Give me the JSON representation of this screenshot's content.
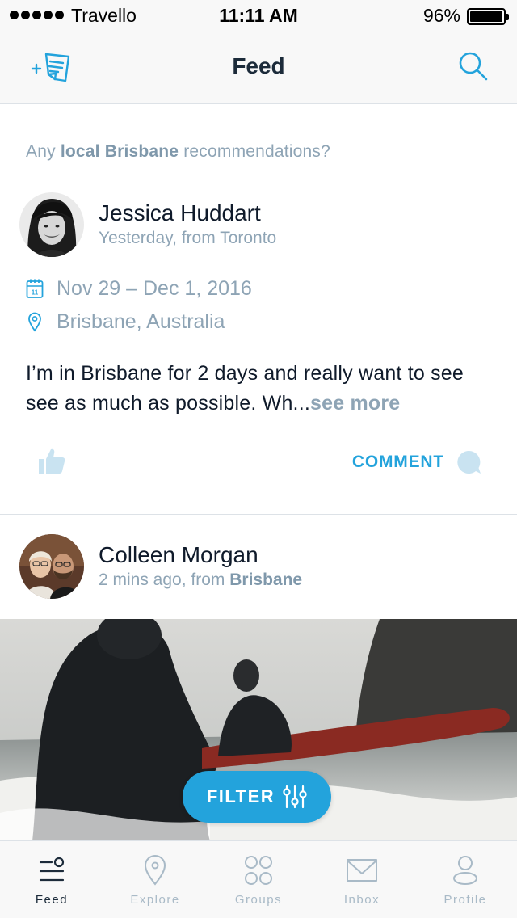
{
  "status_bar": {
    "carrier": "Travello",
    "time": "11:11 AM",
    "battery": "96%"
  },
  "nav": {
    "title": "Feed",
    "compose_icon": "compose-note-icon",
    "search_icon": "search-icon"
  },
  "post1": {
    "question_prefix": "Any ",
    "question_highlight": "local Brisbane",
    "question_suffix": " recommendations?",
    "author": "Jessica Huddart",
    "meta": "Yesterday, from Toronto",
    "dates": "Nov 29 – Dec 1, 2016",
    "location": "Brisbane, Australia",
    "body": "I’m in Brisbane for 2 days and really want to see see as much as possible. Wh...",
    "see_more": "see more",
    "comment_label": "COMMENT"
  },
  "post2": {
    "author": "Colleen Morgan",
    "meta_prefix": "2 mins ago, from ",
    "meta_place": "Brisbane"
  },
  "filter_label": "FILTER",
  "tabs": [
    {
      "label": "Feed",
      "icon": "feed-icon",
      "active": true
    },
    {
      "label": "Explore",
      "icon": "map-pin-icon",
      "active": false
    },
    {
      "label": "Groups",
      "icon": "groups-icon",
      "active": false
    },
    {
      "label": "Inbox",
      "icon": "envelope-icon",
      "active": false
    },
    {
      "label": "Profile",
      "icon": "profile-icon",
      "active": false
    }
  ],
  "colors": {
    "accent": "#23a3dc",
    "muted_text": "#8ea4b5",
    "dark_text": "#0f1a2a"
  }
}
